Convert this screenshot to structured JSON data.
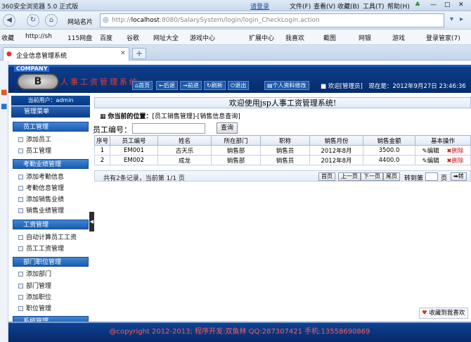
{
  "browser": {
    "window_title": "360安全浏览器 5.0 正式版",
    "account": "请登录",
    "menu": [
      "文件(F)",
      "查看(V)",
      "收藏(B)",
      "工具(T)",
      "帮助(H)"
    ],
    "site_name": "网站名片",
    "url_prefix": "http://",
    "url_host": "localhost",
    "url_path": ":8080/SalarySystem/login/login_CheckLogin.action",
    "favorites": [
      "收藏",
      "http://sh",
      "115网盘",
      "百度",
      "谷歌",
      "网址大全",
      "游戏中心",
      "扩展中心",
      "我喜欢",
      "截图",
      "网银",
      "游戏",
      "登录管家(7)"
    ],
    "tab_title": "企业信息管理系统",
    "new_tab": "+"
  },
  "header": {
    "company": "COMPANY",
    "logo_letter": "B",
    "system_title": "人事工资管理系统",
    "nav_buttons": [
      "首页",
      "后退",
      "前进",
      "刷新",
      "退出"
    ],
    "profile_button": "个人资料修改",
    "welcome": "欢迎[管理员]",
    "current_time_label": "现在是：",
    "current_time": "2012年9月27日 23:46:36"
  },
  "sidebar": {
    "current_user": "当前用户：admin",
    "menu_title": "管理菜单",
    "sections": [
      {
        "title": "员工管理",
        "items": [
          "添加员工",
          "员工管理"
        ]
      },
      {
        "title": "考勤业绩管理",
        "items": [
          "添加考勤信息",
          "考勤信息管理",
          "添加销售业绩",
          "销售业绩管理"
        ]
      },
      {
        "title": "工资管理",
        "items": [
          "自动计算员工工资",
          "员工工资管理"
        ]
      },
      {
        "title": "部门职位管理",
        "items": [
          "添加部门",
          "部门管理",
          "添加职位",
          "职位管理"
        ]
      },
      {
        "title": "系统管理",
        "items": []
      }
    ]
  },
  "main": {
    "banner": "欢迎使用jsp人事工资管理系统!",
    "location_label": "你当前的位置：",
    "location_path": "[员工销售管理]-[销售信息查询]",
    "search_label": "员工编号：",
    "search_value": "",
    "query_button": "查询",
    "columns": [
      "序号",
      "员工编号",
      "姓名",
      "所在部门",
      "职称",
      "销售月份",
      "销售金额",
      "基本操作"
    ],
    "rows": [
      {
        "no": "1",
        "id": "EM001",
        "name": "古天乐",
        "dept": "销售部",
        "title": "销售员",
        "month": "2012年8月",
        "amount": "3500.0",
        "edit": "编辑",
        "delete": "删除"
      },
      {
        "no": "2",
        "id": "EM002",
        "name": "成龙",
        "dept": "销售部",
        "title": "销售员",
        "month": "2012年8月",
        "amount": "4400.0",
        "edit": "编辑",
        "delete": "删除"
      }
    ],
    "pager_info": "共有2条记录，当前第 1/1 页",
    "pager_buttons": [
      "首页",
      "上一页",
      "下一页",
      "尾页"
    ],
    "goto_label": "转到第",
    "page_label": "页",
    "go_button": "转",
    "collect_button": "收藏到我喜欢"
  },
  "footer": {
    "text": "@copyright 2012-2013;  程序开发:双鱼林  QQ:287307421  手机:13558690869"
  }
}
